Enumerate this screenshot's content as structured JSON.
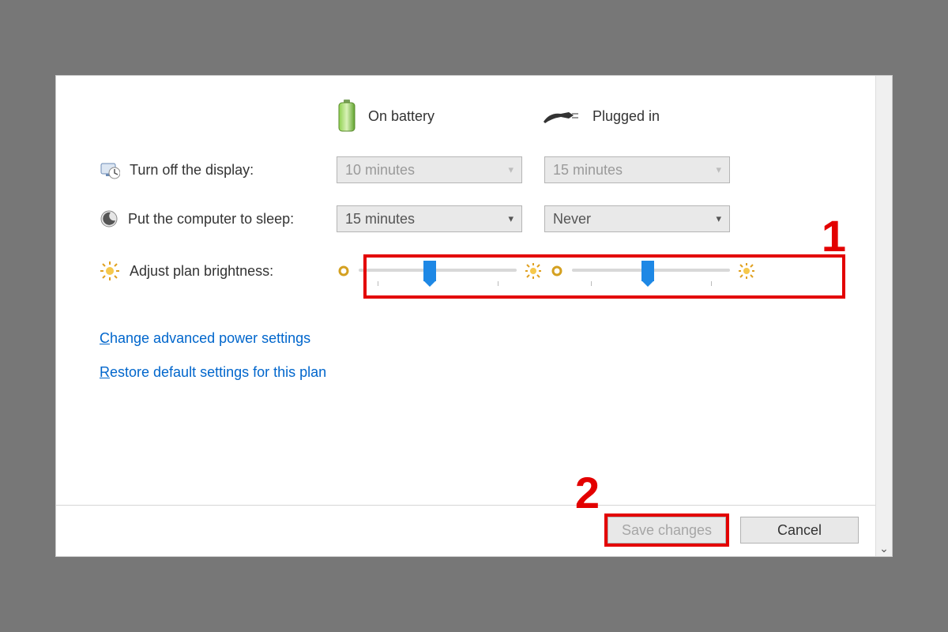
{
  "header": {
    "battery_label": "On battery",
    "plugged_label": "Plugged in"
  },
  "rows": {
    "display": {
      "label": "Turn off the display:",
      "battery": "10 minutes",
      "plugged": "15 minutes",
      "disabled": true
    },
    "sleep": {
      "label": "Put the computer to sleep:",
      "battery": "15 minutes",
      "plugged": "Never",
      "disabled": false
    },
    "brightness": {
      "label": "Adjust plan brightness:",
      "battery_percent": 45,
      "plugged_percent": 48
    }
  },
  "links": {
    "advanced": "Change advanced power settings",
    "advanced_ul": "C",
    "restore": "Restore default settings for this plan",
    "restore_ul": "R"
  },
  "buttons": {
    "save": "Save changes",
    "cancel": "Cancel"
  },
  "annotations": {
    "one": "1",
    "two": "2"
  },
  "colors": {
    "highlight": "#e30000",
    "link": "#0066cc",
    "thumb": "#1e88e5"
  }
}
